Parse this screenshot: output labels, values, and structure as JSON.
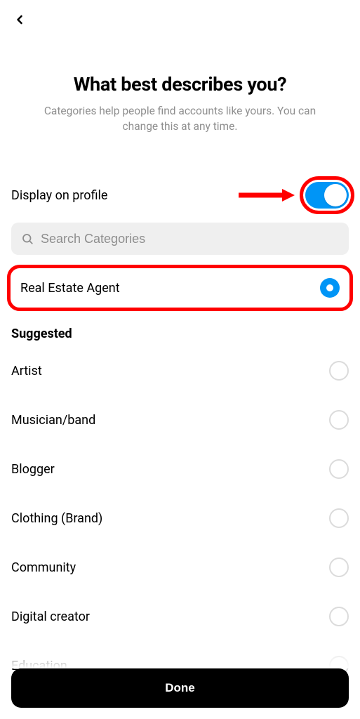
{
  "header": {
    "title": "What best describes you?",
    "subtitle": "Categories help people find accounts like yours. You can change this at any time."
  },
  "display_toggle": {
    "label": "Display on profile",
    "on": true
  },
  "search": {
    "placeholder": "Search Categories"
  },
  "selected_category": {
    "label": "Real Estate Agent"
  },
  "suggested": {
    "heading": "Suggested",
    "items": [
      {
        "label": "Artist"
      },
      {
        "label": "Musician/band"
      },
      {
        "label": "Blogger"
      },
      {
        "label": "Clothing (Brand)"
      },
      {
        "label": "Community"
      },
      {
        "label": "Digital creator"
      },
      {
        "label": "Education"
      }
    ]
  },
  "done": {
    "label": "Done"
  }
}
